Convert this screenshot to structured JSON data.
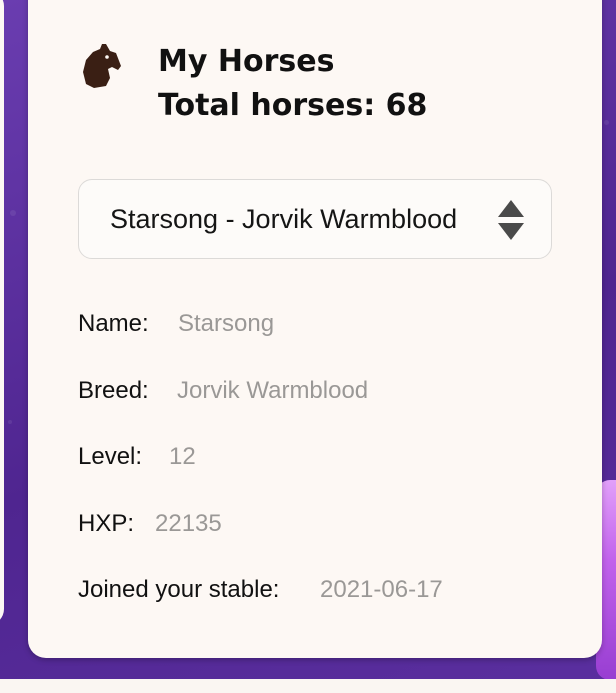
{
  "header": {
    "title": "My Horses",
    "total_horses": "Total horses: 68"
  },
  "horse_select": {
    "selected_value": "Starsong - Jorvik Warmblood"
  },
  "details": {
    "name_label": "Name:",
    "name_value": "Starsong",
    "breed_label": "Breed:",
    "breed_value": "Jorvik Warmblood",
    "level_label": "Level:",
    "level_value": "12",
    "hxp_label": "HXP:",
    "hxp_value": "22135",
    "joined_label": "Joined your stable:",
    "joined_value": "2021-06-17"
  },
  "icons": {
    "header_icon": "horse-head-icon",
    "select_icon": "select-arrows-icon"
  },
  "colors": {
    "background": "#5b2d9a",
    "card": "#fdf8f4",
    "label": "#111111",
    "value": "#9a9896",
    "horse_icon": "#3a1f14"
  }
}
